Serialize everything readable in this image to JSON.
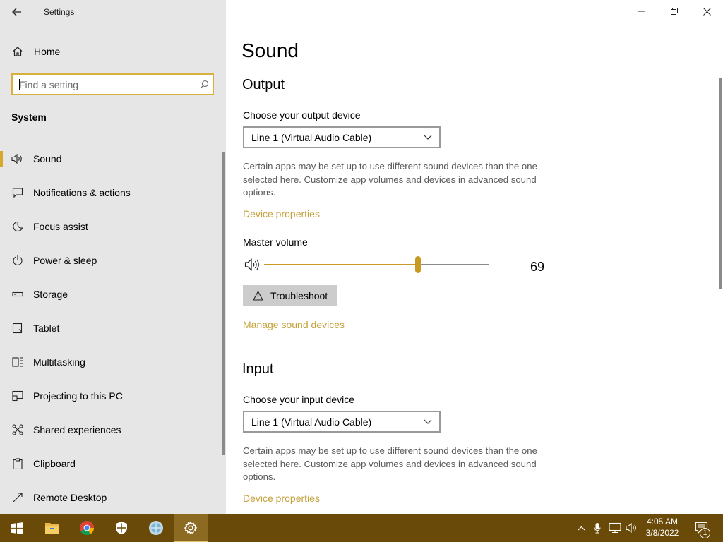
{
  "window": {
    "title": "Settings",
    "controls": {
      "minimize": "minimize",
      "maximize": "restore",
      "close": "close"
    }
  },
  "sidebar": {
    "home_label": "Home",
    "search_placeholder": "Find a setting",
    "section_title": "System",
    "items": [
      {
        "label": "Sound",
        "icon": "speaker-icon",
        "active": true
      },
      {
        "label": "Notifications & actions",
        "icon": "notification-icon"
      },
      {
        "label": "Focus assist",
        "icon": "moon-icon"
      },
      {
        "label": "Power & sleep",
        "icon": "power-icon"
      },
      {
        "label": "Storage",
        "icon": "storage-icon"
      },
      {
        "label": "Tablet",
        "icon": "tablet-icon"
      },
      {
        "label": "Multitasking",
        "icon": "multitasking-icon"
      },
      {
        "label": "Projecting to this PC",
        "icon": "projecting-icon"
      },
      {
        "label": "Shared experiences",
        "icon": "shared-experiences-icon"
      },
      {
        "label": "Clipboard",
        "icon": "clipboard-icon"
      },
      {
        "label": "Remote Desktop",
        "icon": "remote-desktop-icon"
      }
    ]
  },
  "main": {
    "title": "Sound",
    "output": {
      "heading": "Output",
      "device_label": "Choose your output device",
      "device_value": "Line 1 (Virtual Audio Cable)",
      "description": "Certain apps may be set up to use different sound devices than the one selected here. Customize app volumes and devices in advanced sound options.",
      "device_properties_link": "Device properties",
      "master_volume_label": "Master volume",
      "master_volume_value": 69,
      "master_volume_text": "69",
      "troubleshoot_label": "Troubleshoot",
      "manage_devices_link": "Manage sound devices"
    },
    "input": {
      "heading": "Input",
      "device_label": "Choose your input device",
      "device_value": "Line 1 (Virtual Audio Cable)",
      "description": "Certain apps may be set up to use different sound devices than the one selected here. Customize app volumes and devices in advanced sound options.",
      "device_properties_link": "Device properties"
    }
  },
  "taskbar": {
    "apps": [
      "windows-start-icon",
      "file-explorer-icon",
      "chrome-icon",
      "windows-security-icon",
      "web-browser-icon",
      "settings-gear-icon"
    ],
    "active_app": "settings-gear-icon",
    "clock_time": "4:05 AM",
    "clock_date": "3/8/2022",
    "notification_count": "1"
  },
  "colors": {
    "accent": "#c79a24",
    "link": "#c5a13c",
    "sidebar_bg": "#e6e6e6",
    "taskbar_bg": "#6a4a08"
  }
}
